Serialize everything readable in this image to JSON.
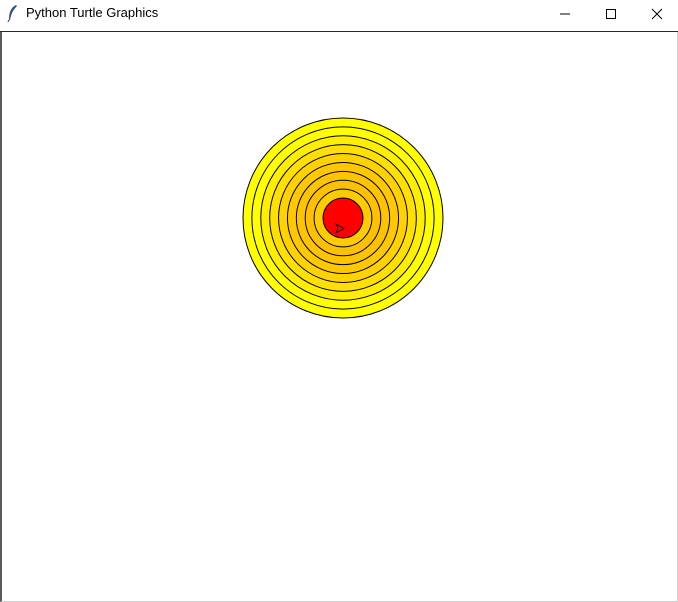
{
  "window": {
    "title": "Python Turtle Graphics",
    "icon": "feather-icon",
    "controls": [
      "minimize-icon",
      "maximize-icon",
      "close-icon"
    ]
  },
  "drawing": {
    "shape": "concentric-circles",
    "ring_count": 10,
    "fill_colors": [
      "#ffff00",
      "#ffff00",
      "#ffee00",
      "#ffe000",
      "#ffd200",
      "#ffc800",
      "#ffc400",
      "#ffc000",
      "#ffcc00",
      "#ff0000"
    ],
    "outline_color": "#000000",
    "center_fill": "#ff0000",
    "turtle_cursor": "arrow-cursor-icon",
    "background": "#ffffff"
  }
}
